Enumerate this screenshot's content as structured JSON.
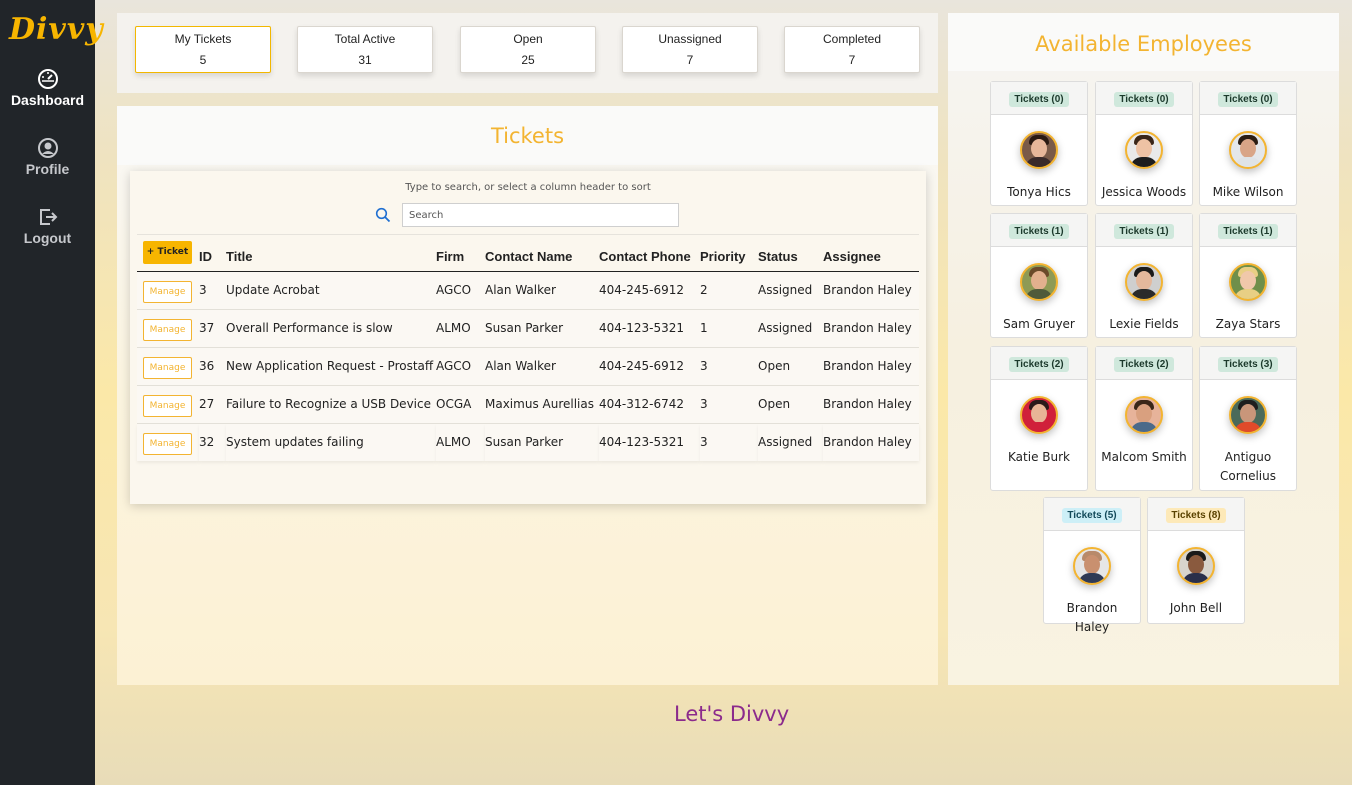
{
  "app": {
    "logo": "Divvy"
  },
  "sidebar": {
    "items": [
      {
        "label": "Dashboard",
        "icon": "dashboard-gauge-icon"
      },
      {
        "label": "Profile",
        "icon": "user-circle-icon"
      },
      {
        "label": "Logout",
        "icon": "logout-icon"
      }
    ]
  },
  "stats": [
    {
      "label": "My Tickets",
      "value": "5"
    },
    {
      "label": "Total Active",
      "value": "31"
    },
    {
      "label": "Open",
      "value": "25"
    },
    {
      "label": "Unassigned",
      "value": "7"
    },
    {
      "label": "Completed",
      "value": "7"
    }
  ],
  "tickets": {
    "title": "Tickets",
    "hint": "Type to search, or select a column header to sort",
    "search_placeholder": "Search",
    "add_label": "+ Ticket",
    "manage_label": "Manage",
    "columns": [
      "ID",
      "Title",
      "Firm",
      "Contact Name",
      "Contact Phone",
      "Priority",
      "Status",
      "Assignee"
    ],
    "rows": [
      {
        "id": "3",
        "title": "Update Acrobat",
        "firm": "AGCO",
        "contact": "Alan Walker",
        "phone": "404-245-6912",
        "priority": "2",
        "status": "Assigned",
        "assignee": "Brandon Haley"
      },
      {
        "id": "37",
        "title": "Overall Performance is slow",
        "firm": "ALMO",
        "contact": "Susan Parker",
        "phone": "404-123-5321",
        "priority": "1",
        "status": "Assigned",
        "assignee": "Brandon Haley"
      },
      {
        "id": "36",
        "title": "New Application Request - Prostaff",
        "firm": "AGCO",
        "contact": "Alan Walker",
        "phone": "404-245-6912",
        "priority": "3",
        "status": "Open",
        "assignee": "Brandon Haley"
      },
      {
        "id": "27",
        "title": "Failure to Recognize a USB Device",
        "firm": "OCGA",
        "contact": "Maximus Aurellias",
        "phone": "404-312-6742",
        "priority": "3",
        "status": "Open",
        "assignee": "Brandon Haley"
      },
      {
        "id": "32",
        "title": "System updates failing",
        "firm": "ALMO",
        "contact": "Susan Parker",
        "phone": "404-123-5321",
        "priority": "3",
        "status": "Assigned",
        "assignee": "Brandon Haley"
      }
    ]
  },
  "employees": {
    "title": "Available Employees",
    "list": [
      {
        "badge": "Tickets (0)",
        "name": "Tonya Hics"
      },
      {
        "badge": "Tickets (0)",
        "name": "Jessica Woods"
      },
      {
        "badge": "Tickets (0)",
        "name": "Mike Wilson"
      },
      {
        "badge": "Tickets (1)",
        "name": "Sam Gruyer"
      },
      {
        "badge": "Tickets (1)",
        "name": "Lexie Fields"
      },
      {
        "badge": "Tickets (1)",
        "name": "Zaya Stars"
      },
      {
        "badge": "Tickets (2)",
        "name": "Katie Burk"
      },
      {
        "badge": "Tickets (2)",
        "name": "Malcom Smith"
      },
      {
        "badge": "Tickets (3)",
        "name": "Antiguo Cornelius"
      },
      {
        "badge": "Tickets (5)",
        "name": "Brandon Haley"
      },
      {
        "badge": "Tickets (8)",
        "name": "John Bell"
      }
    ]
  },
  "colors": {
    "sidebar_bg": "#212529",
    "accent": "#f7b500",
    "title_text": "#f3b431",
    "footer_text": "#8b2a8c"
  },
  "footer": {
    "text": "Let's Divvy"
  }
}
